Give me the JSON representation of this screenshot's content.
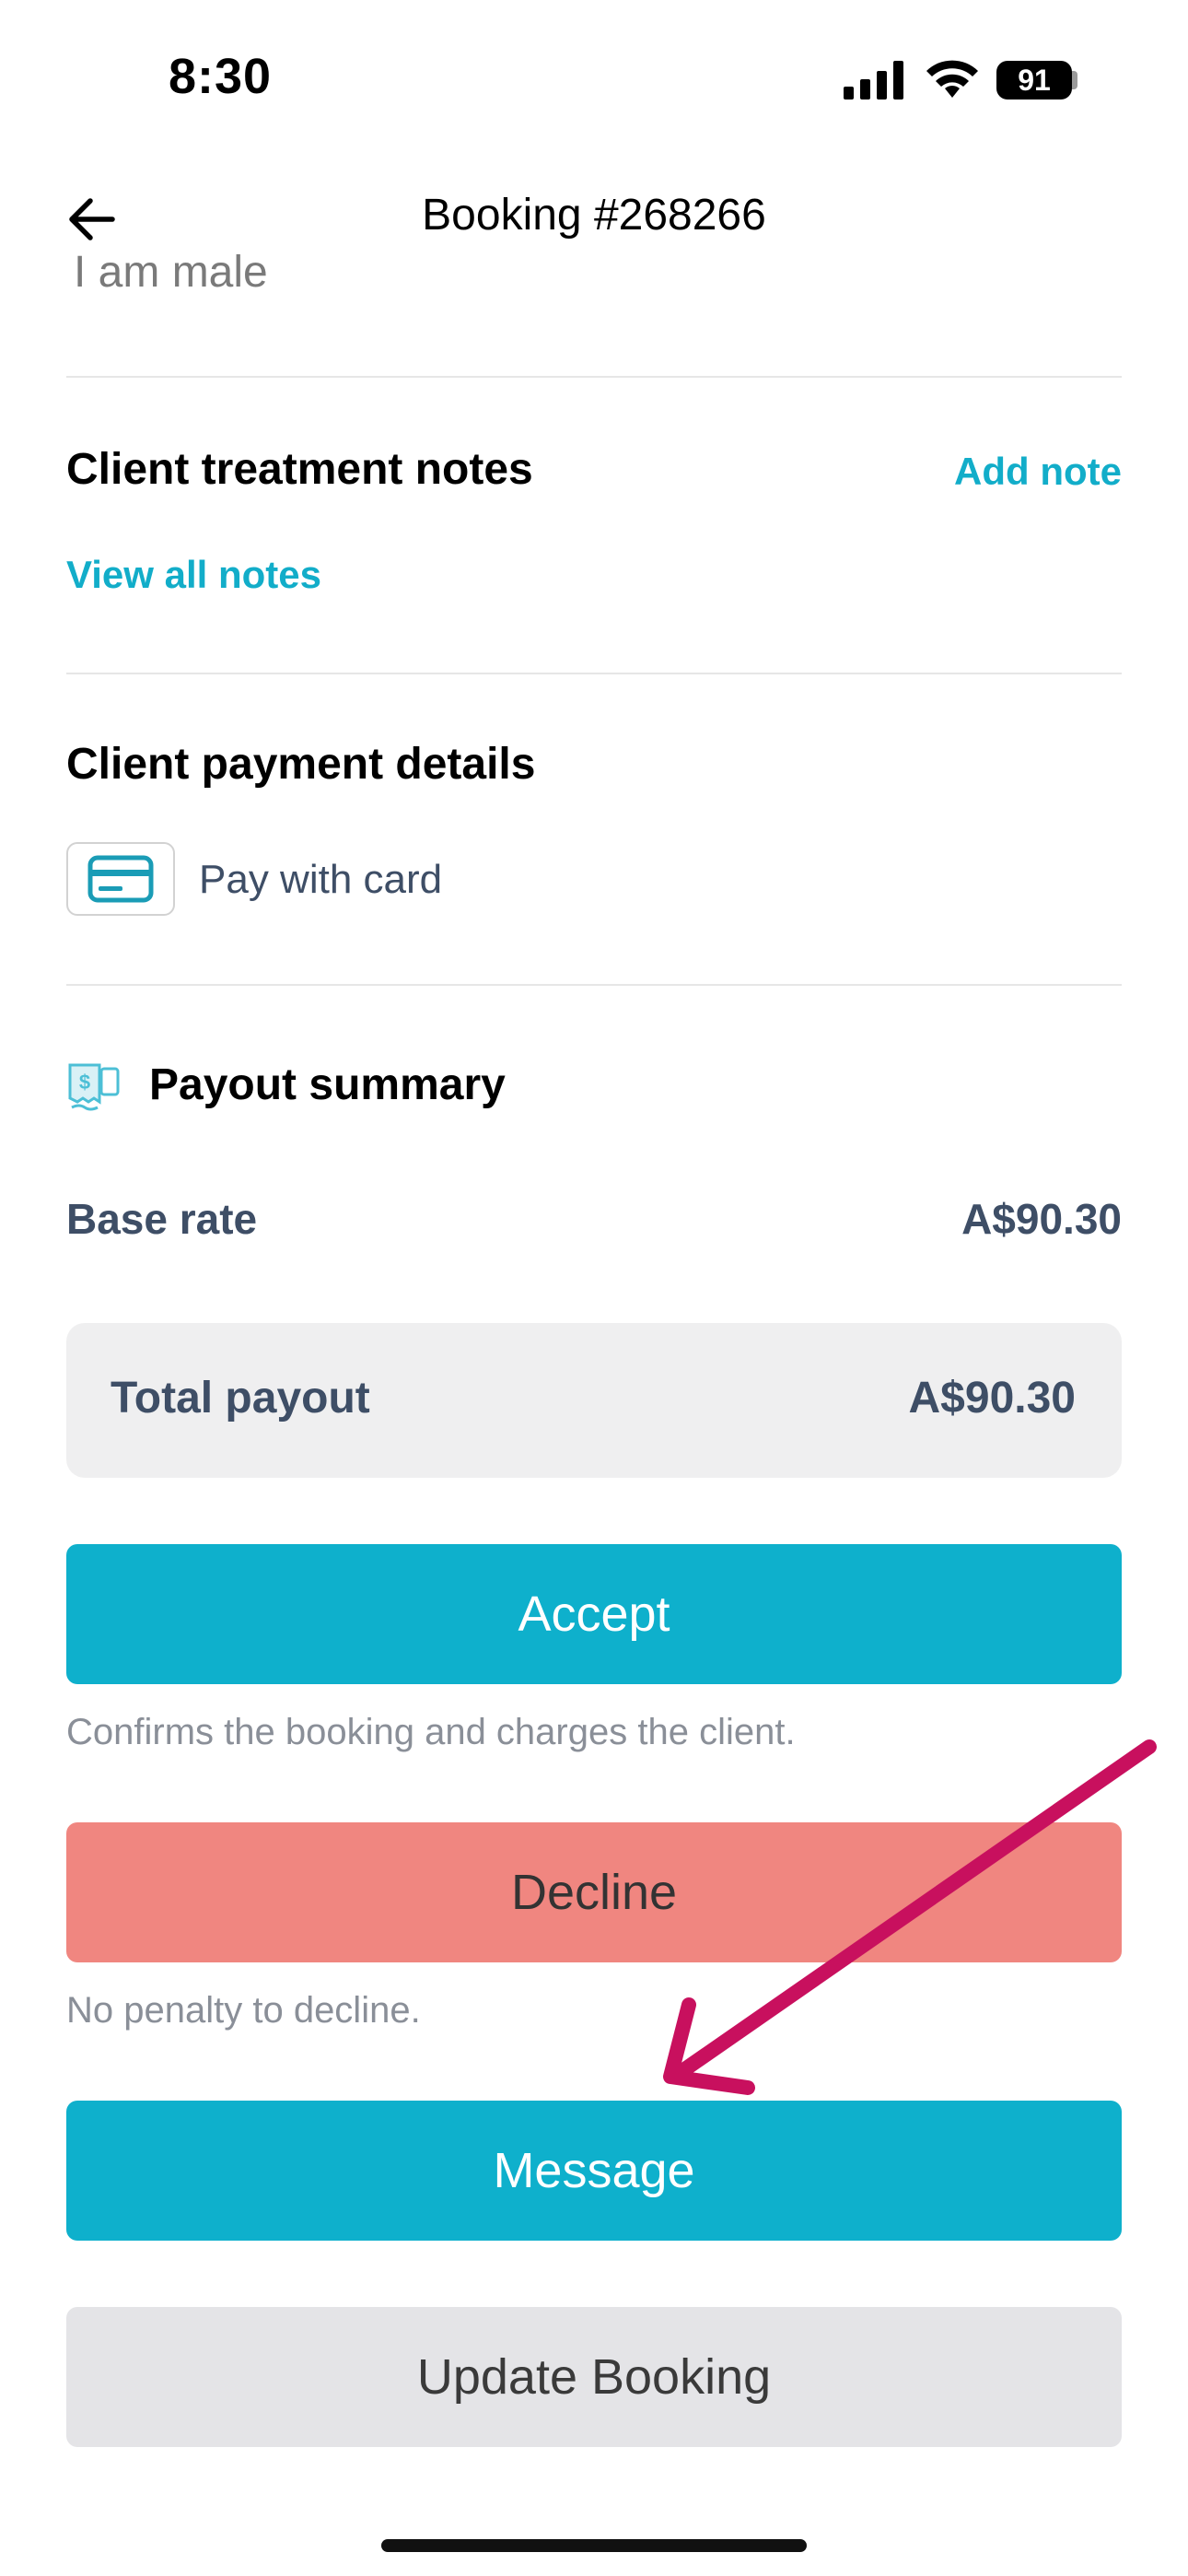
{
  "status_bar": {
    "time": "8:30",
    "battery": "91"
  },
  "nav": {
    "title": "Booking #268266"
  },
  "clipped_text": "I am male",
  "treatment_notes": {
    "title": "Client treatment notes",
    "add_label": "Add note",
    "view_label": "View all notes"
  },
  "payment": {
    "title": "Client payment details",
    "method": "Pay with card"
  },
  "payout": {
    "title": "Payout summary",
    "base_label": "Base rate",
    "base_value": "A$90.30",
    "total_label": "Total payout",
    "total_value": "A$90.30"
  },
  "actions": {
    "accept_label": "Accept",
    "accept_hint": "Confirms the booking and charges the client.",
    "decline_label": "Decline",
    "decline_hint": "No penalty to decline.",
    "message_label": "Message",
    "update_label": "Update Booking"
  },
  "colors": {
    "accent": "#0eb0cc",
    "decline": "#f08680",
    "annotation_arrow": "#c8105e"
  }
}
